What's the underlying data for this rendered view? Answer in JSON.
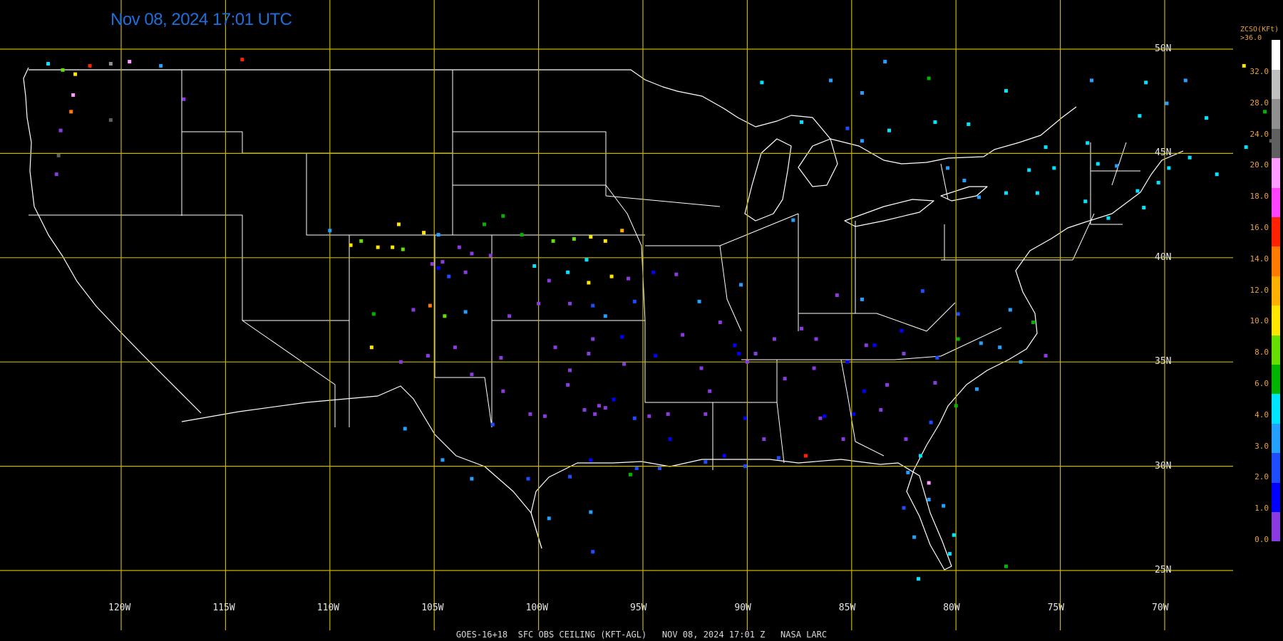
{
  "header": {
    "timestamp": "Nov 08, 2024 17:01 UTC"
  },
  "footer": {
    "caption": "GOES-16+18  SFC OBS CEILING (KFT-AGL)   NOV 08, 2024 17:01 Z   NASA LARC"
  },
  "grid": {
    "lon_labels": [
      "120W",
      "115W",
      "110W",
      "105W",
      "100W",
      "95W",
      "90W",
      "85W",
      "80W",
      "75W",
      "70W"
    ],
    "lat_labels": [
      "50N",
      "45N",
      "40N",
      "35N",
      "30N",
      "25N"
    ]
  },
  "colorbar": {
    "title_line1": "ZCSO(KFt)",
    "title_line2": ">36.0",
    "ticks": [
      "32.0",
      "28.0",
      "24.0",
      "20.0",
      "18.0",
      "16.0",
      "14.0",
      "12.0",
      "10.0",
      "8.0",
      "6.0",
      "4.0",
      "3.0",
      "2.0",
      "1.0",
      "0.0"
    ],
    "colors": [
      "#8a3be0",
      "#0000ff",
      "#1f4cff",
      "#24a0ff",
      "#00e5ff",
      "#00b400",
      "#66e000",
      "#ffe600",
      "#ffb000",
      "#ff7a00",
      "#ff2200",
      "#ff44ff",
      "#ff9cff",
      "#606060",
      "#909090",
      "#c0c0c0",
      "#ffffff"
    ]
  },
  "colors": {
    "grid": "#c8b400",
    "borders": "#ffffff",
    "timestamp": "#1e6fd9",
    "labels": "#e8a33a"
  },
  "stations": [
    {
      "lon": -123.5,
      "lat": 49.3,
      "c": "#00e5ff"
    },
    {
      "lon": -122.8,
      "lat": 49.0,
      "c": "#66e000"
    },
    {
      "lon": -122.2,
      "lat": 48.8,
      "c": "#ffe600"
    },
    {
      "lon": -121.5,
      "lat": 49.2,
      "c": "#ff2200"
    },
    {
      "lon": -120.5,
      "lat": 49.3,
      "c": "#909090"
    },
    {
      "lon": -119.6,
      "lat": 49.4,
      "c": "#ff9cff"
    },
    {
      "lon": -118.1,
      "lat": 49.2,
      "c": "#24a0ff"
    },
    {
      "lon": -114.2,
      "lat": 49.5,
      "c": "#ff2200"
    },
    {
      "lon": -122.3,
      "lat": 47.8,
      "c": "#ff9cff"
    },
    {
      "lon": -122.4,
      "lat": 47.0,
      "c": "#ff7a00"
    },
    {
      "lon": -120.5,
      "lat": 46.6,
      "c": "#606060"
    },
    {
      "lon": -117.0,
      "lat": 47.6,
      "c": "#8a3be0"
    },
    {
      "lon": -122.9,
      "lat": 46.1,
      "c": "#8a3be0"
    },
    {
      "lon": -123.0,
      "lat": 44.9,
      "c": "#606060"
    },
    {
      "lon": -123.1,
      "lat": 44.0,
      "c": "#8a3be0"
    },
    {
      "lon": -110.0,
      "lat": 41.3,
      "c": "#24a0ff"
    },
    {
      "lon": -109.0,
      "lat": 40.6,
      "c": "#ffe600"
    },
    {
      "lon": -108.5,
      "lat": 40.8,
      "c": "#66e000"
    },
    {
      "lon": -107.7,
      "lat": 40.5,
      "c": "#ffe600"
    },
    {
      "lon": -107.0,
      "lat": 40.5,
      "c": "#ffe600"
    },
    {
      "lon": -106.5,
      "lat": 40.4,
      "c": "#66e000"
    },
    {
      "lon": -106.7,
      "lat": 41.6,
      "c": "#ffe600"
    },
    {
      "lon": -105.5,
      "lat": 41.2,
      "c": "#ffe600"
    },
    {
      "lon": -104.8,
      "lat": 41.1,
      "c": "#24a0ff"
    },
    {
      "lon": -104.6,
      "lat": 39.8,
      "c": "#8a3be0"
    },
    {
      "lon": -104.8,
      "lat": 39.5,
      "c": "#0000ff"
    },
    {
      "lon": -105.1,
      "lat": 39.7,
      "c": "#8a3be0"
    },
    {
      "lon": -104.3,
      "lat": 39.1,
      "c": "#1f4cff"
    },
    {
      "lon": -103.5,
      "lat": 39.3,
      "c": "#8a3be0"
    },
    {
      "lon": -103.2,
      "lat": 40.2,
      "c": "#8a3be0"
    },
    {
      "lon": -102.3,
      "lat": 40.1,
      "c": "#8a3be0"
    },
    {
      "lon": -103.8,
      "lat": 40.5,
      "c": "#8a3be0"
    },
    {
      "lon": -102.6,
      "lat": 41.6,
      "c": "#00b400"
    },
    {
      "lon": -101.7,
      "lat": 42.0,
      "c": "#00b400"
    },
    {
      "lon": -100.8,
      "lat": 41.1,
      "c": "#00b400"
    },
    {
      "lon": -100.2,
      "lat": 39.6,
      "c": "#00e5ff"
    },
    {
      "lon": -99.3,
      "lat": 40.8,
      "c": "#66e000"
    },
    {
      "lon": -98.3,
      "lat": 40.9,
      "c": "#66e000"
    },
    {
      "lon": -97.5,
      "lat": 41.0,
      "c": "#ffe600"
    },
    {
      "lon": -96.8,
      "lat": 40.8,
      "c": "#ffe600"
    },
    {
      "lon": -96.0,
      "lat": 41.3,
      "c": "#ffb000"
    },
    {
      "lon": -97.7,
      "lat": 39.9,
      "c": "#00e5ff"
    },
    {
      "lon": -98.6,
      "lat": 39.3,
      "c": "#00e5ff"
    },
    {
      "lon": -99.5,
      "lat": 38.9,
      "c": "#8a3be0"
    },
    {
      "lon": -97.6,
      "lat": 38.8,
      "c": "#ffe600"
    },
    {
      "lon": -96.5,
      "lat": 39.1,
      "c": "#ffe600"
    },
    {
      "lon": -95.7,
      "lat": 39.0,
      "c": "#8a3be0"
    },
    {
      "lon": -97.4,
      "lat": 37.7,
      "c": "#1f4cff"
    },
    {
      "lon": -98.5,
      "lat": 37.8,
      "c": "#8a3be0"
    },
    {
      "lon": -100.0,
      "lat": 37.8,
      "c": "#8a3be0"
    },
    {
      "lon": -101.4,
      "lat": 37.2,
      "c": "#8a3be0"
    },
    {
      "lon": -95.4,
      "lat": 37.9,
      "c": "#1f4cff"
    },
    {
      "lon": -96.8,
      "lat": 37.2,
      "c": "#24a0ff"
    },
    {
      "lon": -94.5,
      "lat": 39.3,
      "c": "#0000ff"
    },
    {
      "lon": -93.4,
      "lat": 39.2,
      "c": "#8a3be0"
    },
    {
      "lon": -92.3,
      "lat": 37.9,
      "c": "#24a0ff"
    },
    {
      "lon": -91.3,
      "lat": 36.9,
      "c": "#8a3be0"
    },
    {
      "lon": -107.9,
      "lat": 37.3,
      "c": "#00b400"
    },
    {
      "lon": -106.0,
      "lat": 37.5,
      "c": "#8a3be0"
    },
    {
      "lon": -105.2,
      "lat": 37.7,
      "c": "#ff7a00"
    },
    {
      "lon": -104.5,
      "lat": 37.2,
      "c": "#66e000"
    },
    {
      "lon": -103.5,
      "lat": 37.4,
      "c": "#24a0ff"
    },
    {
      "lon": -108.0,
      "lat": 35.7,
      "c": "#ffe600"
    },
    {
      "lon": -106.6,
      "lat": 35.0,
      "c": "#8a3be0"
    },
    {
      "lon": -105.3,
      "lat": 35.3,
      "c": "#8a3be0"
    },
    {
      "lon": -104.0,
      "lat": 35.7,
      "c": "#8a3be0"
    },
    {
      "lon": -103.2,
      "lat": 34.4,
      "c": "#8a3be0"
    },
    {
      "lon": -101.8,
      "lat": 35.2,
      "c": "#8a3be0"
    },
    {
      "lon": -101.7,
      "lat": 33.6,
      "c": "#8a3be0"
    },
    {
      "lon": -102.2,
      "lat": 32.0,
      "c": "#1f4cff"
    },
    {
      "lon": -100.4,
      "lat": 32.5,
      "c": "#8a3be0"
    },
    {
      "lon": -99.7,
      "lat": 32.4,
      "c": "#8a3be0"
    },
    {
      "lon": -98.6,
      "lat": 33.9,
      "c": "#8a3be0"
    },
    {
      "lon": -97.1,
      "lat": 32.9,
      "c": "#8a3be0"
    },
    {
      "lon": -96.8,
      "lat": 32.8,
      "c": "#8a3be0"
    },
    {
      "lon": -97.3,
      "lat": 32.5,
      "c": "#8a3be0"
    },
    {
      "lon": -97.8,
      "lat": 32.7,
      "c": "#8a3be0"
    },
    {
      "lon": -96.4,
      "lat": 33.2,
      "c": "#0000ff"
    },
    {
      "lon": -95.4,
      "lat": 32.3,
      "c": "#1f4cff"
    },
    {
      "lon": -94.7,
      "lat": 32.4,
      "c": "#8a3be0"
    },
    {
      "lon": -93.8,
      "lat": 32.5,
      "c": "#8a3be0"
    },
    {
      "lon": -97.6,
      "lat": 35.4,
      "c": "#8a3be0"
    },
    {
      "lon": -97.4,
      "lat": 36.1,
      "c": "#8a3be0"
    },
    {
      "lon": -96.0,
      "lat": 36.2,
      "c": "#0000ff"
    },
    {
      "lon": -95.9,
      "lat": 34.9,
      "c": "#8a3be0"
    },
    {
      "lon": -98.5,
      "lat": 34.6,
      "c": "#8a3be0"
    },
    {
      "lon": -99.2,
      "lat": 35.7,
      "c": "#8a3be0"
    },
    {
      "lon": -94.4,
      "lat": 35.3,
      "c": "#0000ff"
    },
    {
      "lon": -92.2,
      "lat": 34.7,
      "c": "#8a3be0"
    },
    {
      "lon": -91.8,
      "lat": 33.6,
      "c": "#8a3be0"
    },
    {
      "lon": -93.1,
      "lat": 36.3,
      "c": "#8a3be0"
    },
    {
      "lon": -90.6,
      "lat": 35.8,
      "c": "#0000ff"
    },
    {
      "lon": -90.0,
      "lat": 35.0,
      "c": "#8a3be0"
    },
    {
      "lon": -89.6,
      "lat": 35.4,
      "c": "#8a3be0"
    },
    {
      "lon": -88.7,
      "lat": 36.1,
      "c": "#8a3be0"
    },
    {
      "lon": -87.4,
      "lat": 36.6,
      "c": "#8a3be0"
    },
    {
      "lon": -86.7,
      "lat": 36.1,
      "c": "#8a3be0"
    },
    {
      "lon": -85.2,
      "lat": 35.0,
      "c": "#0000ff"
    },
    {
      "lon": -84.3,
      "lat": 35.8,
      "c": "#8a3be0"
    },
    {
      "lon": -83.9,
      "lat": 35.8,
      "c": "#0000ff"
    },
    {
      "lon": -86.8,
      "lat": 34.7,
      "c": "#8a3be0"
    },
    {
      "lon": -88.2,
      "lat": 34.2,
      "c": "#8a3be0"
    },
    {
      "lon": -90.1,
      "lat": 32.3,
      "c": "#0000ff"
    },
    {
      "lon": -89.2,
      "lat": 31.3,
      "c": "#8a3be0"
    },
    {
      "lon": -88.5,
      "lat": 30.4,
      "c": "#1f4cff"
    },
    {
      "lon": -87.2,
      "lat": 30.5,
      "c": "#ff2200"
    },
    {
      "lon": -86.5,
      "lat": 32.3,
      "c": "#8a3be0"
    },
    {
      "lon": -85.4,
      "lat": 31.3,
      "c": "#8a3be0"
    },
    {
      "lon": -84.4,
      "lat": 33.6,
      "c": "#0000ff"
    },
    {
      "lon": -83.3,
      "lat": 33.9,
      "c": "#8a3be0"
    },
    {
      "lon": -83.6,
      "lat": 32.7,
      "c": "#8a3be0"
    },
    {
      "lon": -84.9,
      "lat": 32.5,
      "c": "#0000ff"
    },
    {
      "lon": -82.4,
      "lat": 31.3,
      "c": "#8a3be0"
    },
    {
      "lon": -81.2,
      "lat": 32.1,
      "c": "#1f4cff"
    },
    {
      "lon": -81.0,
      "lat": 34.0,
      "c": "#8a3be0"
    },
    {
      "lon": -80.0,
      "lat": 32.9,
      "c": "#00b400"
    },
    {
      "lon": -79.0,
      "lat": 33.7,
      "c": "#24a0ff"
    },
    {
      "lon": -80.9,
      "lat": 35.2,
      "c": "#1f4cff"
    },
    {
      "lon": -79.9,
      "lat": 36.1,
      "c": "#00b400"
    },
    {
      "lon": -78.8,
      "lat": 35.9,
      "c": "#24a0ff"
    },
    {
      "lon": -77.9,
      "lat": 35.7,
      "c": "#24a0ff"
    },
    {
      "lon": -76.9,
      "lat": 35.0,
      "c": "#24a0ff"
    },
    {
      "lon": -75.7,
      "lat": 35.3,
      "c": "#8a3be0"
    },
    {
      "lon": -76.3,
      "lat": 36.9,
      "c": "#00b400"
    },
    {
      "lon": -77.4,
      "lat": 37.5,
      "c": "#24a0ff"
    },
    {
      "lon": -79.9,
      "lat": 37.3,
      "c": "#1f4cff"
    },
    {
      "lon": -81.6,
      "lat": 38.4,
      "c": "#1f4cff"
    },
    {
      "lon": -82.6,
      "lat": 36.5,
      "c": "#0000ff"
    },
    {
      "lon": -84.5,
      "lat": 38.0,
      "c": "#24a0ff"
    },
    {
      "lon": -85.7,
      "lat": 38.2,
      "c": "#8a3be0"
    },
    {
      "lon": -81.7,
      "lat": 30.5,
      "c": "#00e5ff"
    },
    {
      "lon": -82.3,
      "lat": 29.7,
      "c": "#24a0ff"
    },
    {
      "lon": -81.3,
      "lat": 29.2,
      "c": "#ff9cff"
    },
    {
      "lon": -82.5,
      "lat": 28.0,
      "c": "#1f4cff"
    },
    {
      "lon": -81.3,
      "lat": 28.4,
      "c": "#24a0ff"
    },
    {
      "lon": -80.6,
      "lat": 28.1,
      "c": "#24a0ff"
    },
    {
      "lon": -82.0,
      "lat": 26.6,
      "c": "#24a0ff"
    },
    {
      "lon": -80.1,
      "lat": 26.7,
      "c": "#00e5ff"
    },
    {
      "lon": -80.3,
      "lat": 25.8,
      "c": "#00e5ff"
    },
    {
      "lon": -81.8,
      "lat": 24.6,
      "c": "#00e5ff"
    },
    {
      "lon": -77.6,
      "lat": 25.2,
      "c": "#00b400"
    },
    {
      "lon": -95.3,
      "lat": 29.9,
      "c": "#1f4cff"
    },
    {
      "lon": -94.2,
      "lat": 29.9,
      "c": "#1f4cff"
    },
    {
      "lon": -95.6,
      "lat": 29.6,
      "c": "#00b400"
    },
    {
      "lon": -97.5,
      "lat": 30.3,
      "c": "#0000ff"
    },
    {
      "lon": -98.5,
      "lat": 29.5,
      "c": "#1f4cff"
    },
    {
      "lon": -97.5,
      "lat": 27.8,
      "c": "#24a0ff"
    },
    {
      "lon": -97.4,
      "lat": 25.9,
      "c": "#1f4cff"
    },
    {
      "lon": -99.5,
      "lat": 27.5,
      "c": "#24a0ff"
    },
    {
      "lon": -100.5,
      "lat": 29.4,
      "c": "#1f4cff"
    },
    {
      "lon": -103.2,
      "lat": 29.4,
      "c": "#24a0ff"
    },
    {
      "lon": -104.6,
      "lat": 30.3,
      "c": "#24a0ff"
    },
    {
      "lon": -106.4,
      "lat": 31.8,
      "c": "#24a0ff"
    },
    {
      "lon": -92.0,
      "lat": 30.2,
      "c": "#1f4cff"
    },
    {
      "lon": -91.1,
      "lat": 30.5,
      "c": "#0000ff"
    },
    {
      "lon": -90.1,
      "lat": 30.0,
      "c": "#1f4cff"
    },
    {
      "lon": -92.0,
      "lat": 32.5,
      "c": "#8a3be0"
    },
    {
      "lon": -93.7,
      "lat": 31.3,
      "c": "#0000ff"
    },
    {
      "lon": -87.8,
      "lat": 41.8,
      "c": "#24a0ff"
    },
    {
      "lon": -84.5,
      "lat": 45.6,
      "c": "#24a0ff"
    },
    {
      "lon": -85.2,
      "lat": 46.2,
      "c": "#1f4cff"
    },
    {
      "lon": -87.4,
      "lat": 46.5,
      "c": "#00e5ff"
    },
    {
      "lon": -84.5,
      "lat": 47.9,
      "c": "#24a0ff"
    },
    {
      "lon": -83.2,
      "lat": 46.1,
      "c": "#00e5ff"
    },
    {
      "lon": -81.0,
      "lat": 46.5,
      "c": "#00e5ff"
    },
    {
      "lon": -79.4,
      "lat": 46.4,
      "c": "#00e5ff"
    },
    {
      "lon": -80.4,
      "lat": 44.3,
      "c": "#24a0ff"
    },
    {
      "lon": -79.6,
      "lat": 43.7,
      "c": "#24a0ff"
    },
    {
      "lon": -78.9,
      "lat": 42.9,
      "c": "#24a0ff"
    },
    {
      "lon": -77.6,
      "lat": 43.1,
      "c": "#00e5ff"
    },
    {
      "lon": -76.1,
      "lat": 43.1,
      "c": "#00e5ff"
    },
    {
      "lon": -75.3,
      "lat": 44.3,
      "c": "#00e5ff"
    },
    {
      "lon": -73.8,
      "lat": 42.7,
      "c": "#00e5ff"
    },
    {
      "lon": -73.2,
      "lat": 44.5,
      "c": "#00e5ff"
    },
    {
      "lon": -72.3,
      "lat": 44.4,
      "c": "#24a0ff"
    },
    {
      "lon": -71.3,
      "lat": 43.2,
      "c": "#00e5ff"
    },
    {
      "lon": -70.3,
      "lat": 43.6,
      "c": "#00e5ff"
    },
    {
      "lon": -69.8,
      "lat": 44.3,
      "c": "#00e5ff"
    },
    {
      "lon": -68.8,
      "lat": 44.8,
      "c": "#00e5ff"
    },
    {
      "lon": -68.0,
      "lat": 46.7,
      "c": "#00e5ff"
    },
    {
      "lon": -69.9,
      "lat": 47.4,
      "c": "#24a0ff"
    },
    {
      "lon": -71.2,
      "lat": 46.8,
      "c": "#00e5ff"
    },
    {
      "lon": -73.7,
      "lat": 45.5,
      "c": "#00e5ff"
    },
    {
      "lon": -75.7,
      "lat": 45.3,
      "c": "#00e5ff"
    },
    {
      "lon": -76.5,
      "lat": 44.2,
      "c": "#00e5ff"
    },
    {
      "lon": -72.7,
      "lat": 41.9,
      "c": "#00e5ff"
    },
    {
      "lon": -71.0,
      "lat": 42.4,
      "c": "#00e5ff"
    },
    {
      "lon": -66.1,
      "lat": 45.3,
      "c": "#00e5ff"
    },
    {
      "lon": -67.5,
      "lat": 44.0,
      "c": "#00e5ff"
    },
    {
      "lon": -69.0,
      "lat": 48.5,
      "c": "#24a0ff"
    },
    {
      "lon": -66.2,
      "lat": 49.2,
      "c": "#ffe600"
    },
    {
      "lon": -65.2,
      "lat": 47.0,
      "c": "#00b400"
    },
    {
      "lon": -64.9,
      "lat": 45.6,
      "c": "#606060"
    },
    {
      "lon": -70.9,
      "lat": 48.4,
      "c": "#00e5ff"
    },
    {
      "lon": -73.5,
      "lat": 48.5,
      "c": "#24a0ff"
    },
    {
      "lon": -77.6,
      "lat": 48.0,
      "c": "#00e5ff"
    },
    {
      "lon": -81.3,
      "lat": 48.6,
      "c": "#00b400"
    },
    {
      "lon": -83.4,
      "lat": 49.4,
      "c": "#24a0ff"
    },
    {
      "lon": -86.0,
      "lat": 48.5,
      "c": "#24a0ff"
    },
    {
      "lon": -89.3,
      "lat": 48.4,
      "c": "#00e5ff"
    },
    {
      "lon": -90.3,
      "lat": 38.7,
      "c": "#24a0ff"
    },
    {
      "lon": -90.4,
      "lat": 35.4,
      "c": "#0000ff"
    },
    {
      "lon": -82.5,
      "lat": 35.4,
      "c": "#8a3be0"
    },
    {
      "lon": -86.3,
      "lat": 32.4,
      "c": "#0000ff"
    }
  ]
}
